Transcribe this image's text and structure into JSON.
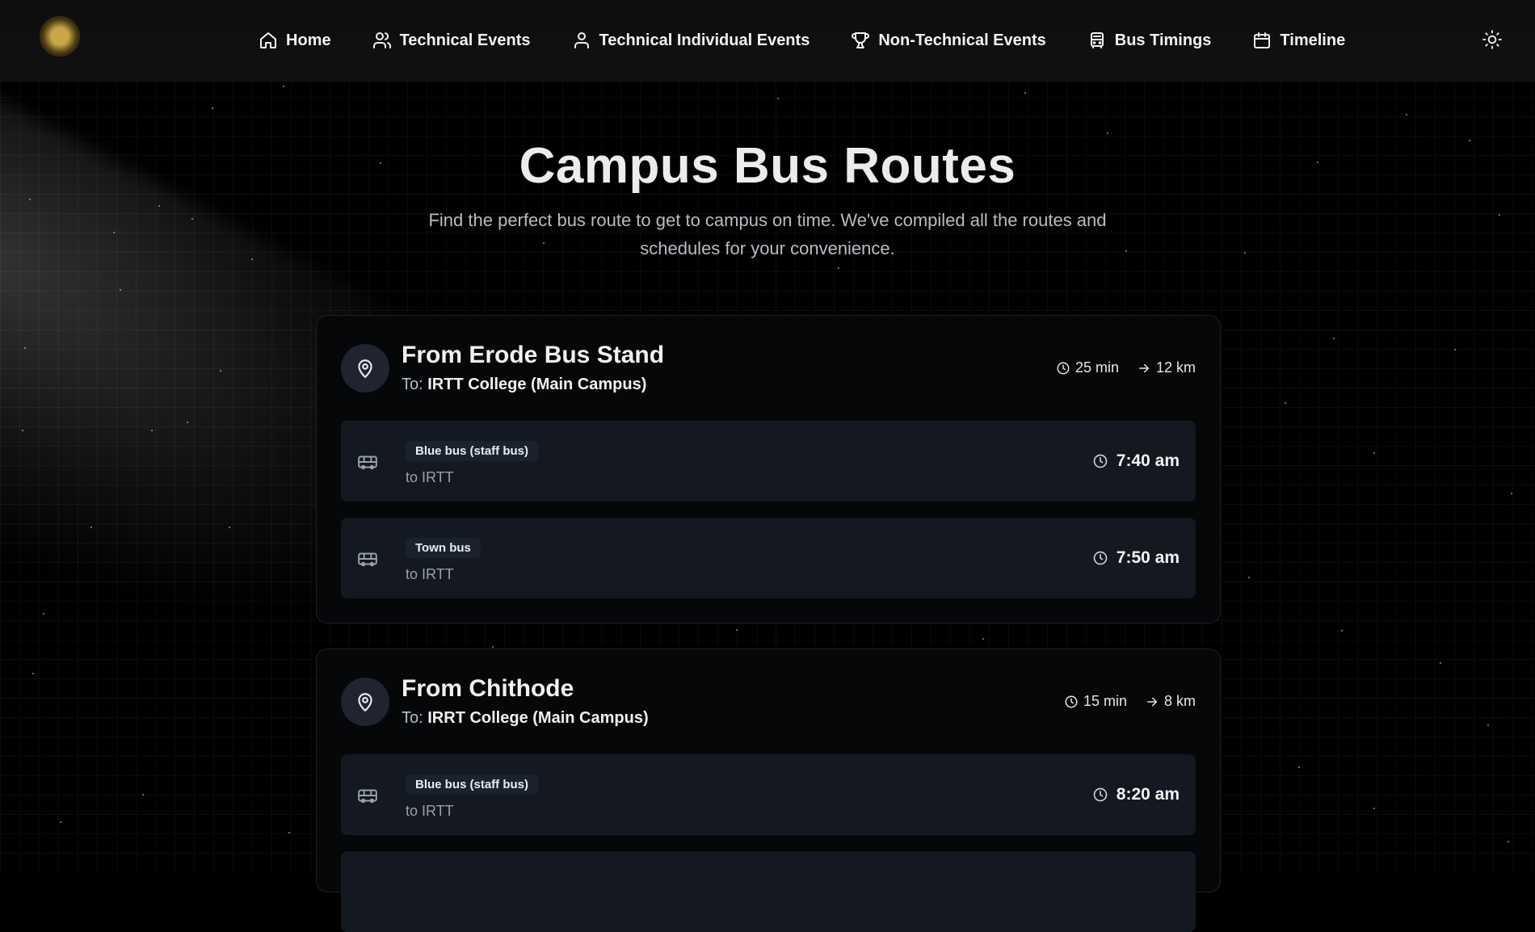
{
  "nav": {
    "items": [
      {
        "label": "Home",
        "icon": "home-icon"
      },
      {
        "label": "Technical Events",
        "icon": "users-icon"
      },
      {
        "label": "Technical Individual Events",
        "icon": "user-icon"
      },
      {
        "label": "Non-Technical Events",
        "icon": "trophy-icon"
      },
      {
        "label": "Bus Timings",
        "icon": "bus-icon"
      },
      {
        "label": "Timeline",
        "icon": "calendar-icon"
      }
    ],
    "theme_icon": "sun-icon"
  },
  "hero": {
    "title": "Campus Bus Routes",
    "subtitle": "Find the perfect bus route to get to campus on time. We've compiled all the routes and schedules for your convenience."
  },
  "routes": [
    {
      "title": "From Erode Bus Stand",
      "to_label": "To:",
      "destination": "IRTT College (Main Campus)",
      "duration": "25 min",
      "distance": "12 km",
      "trips": [
        {
          "bus": "Blue bus (staff bus)",
          "to": "to IRTT",
          "time": "7:40 am"
        },
        {
          "bus": "Town bus",
          "to": "to IRTT",
          "time": "7:50 am"
        }
      ]
    },
    {
      "title": "From Chithode",
      "to_label": "To:",
      "destination": "IRRT College (Main Campus)",
      "duration": "15 min",
      "distance": "8 km",
      "trips": [
        {
          "bus": "Blue bus (staff bus)",
          "to": "to IRTT",
          "time": "8:20 am"
        }
      ]
    }
  ],
  "colors": {
    "background": "#000000",
    "card": "#060709",
    "trip_row": "#131821",
    "accent_text": "#f1f1f1",
    "muted_text": "#b7bcc4"
  }
}
